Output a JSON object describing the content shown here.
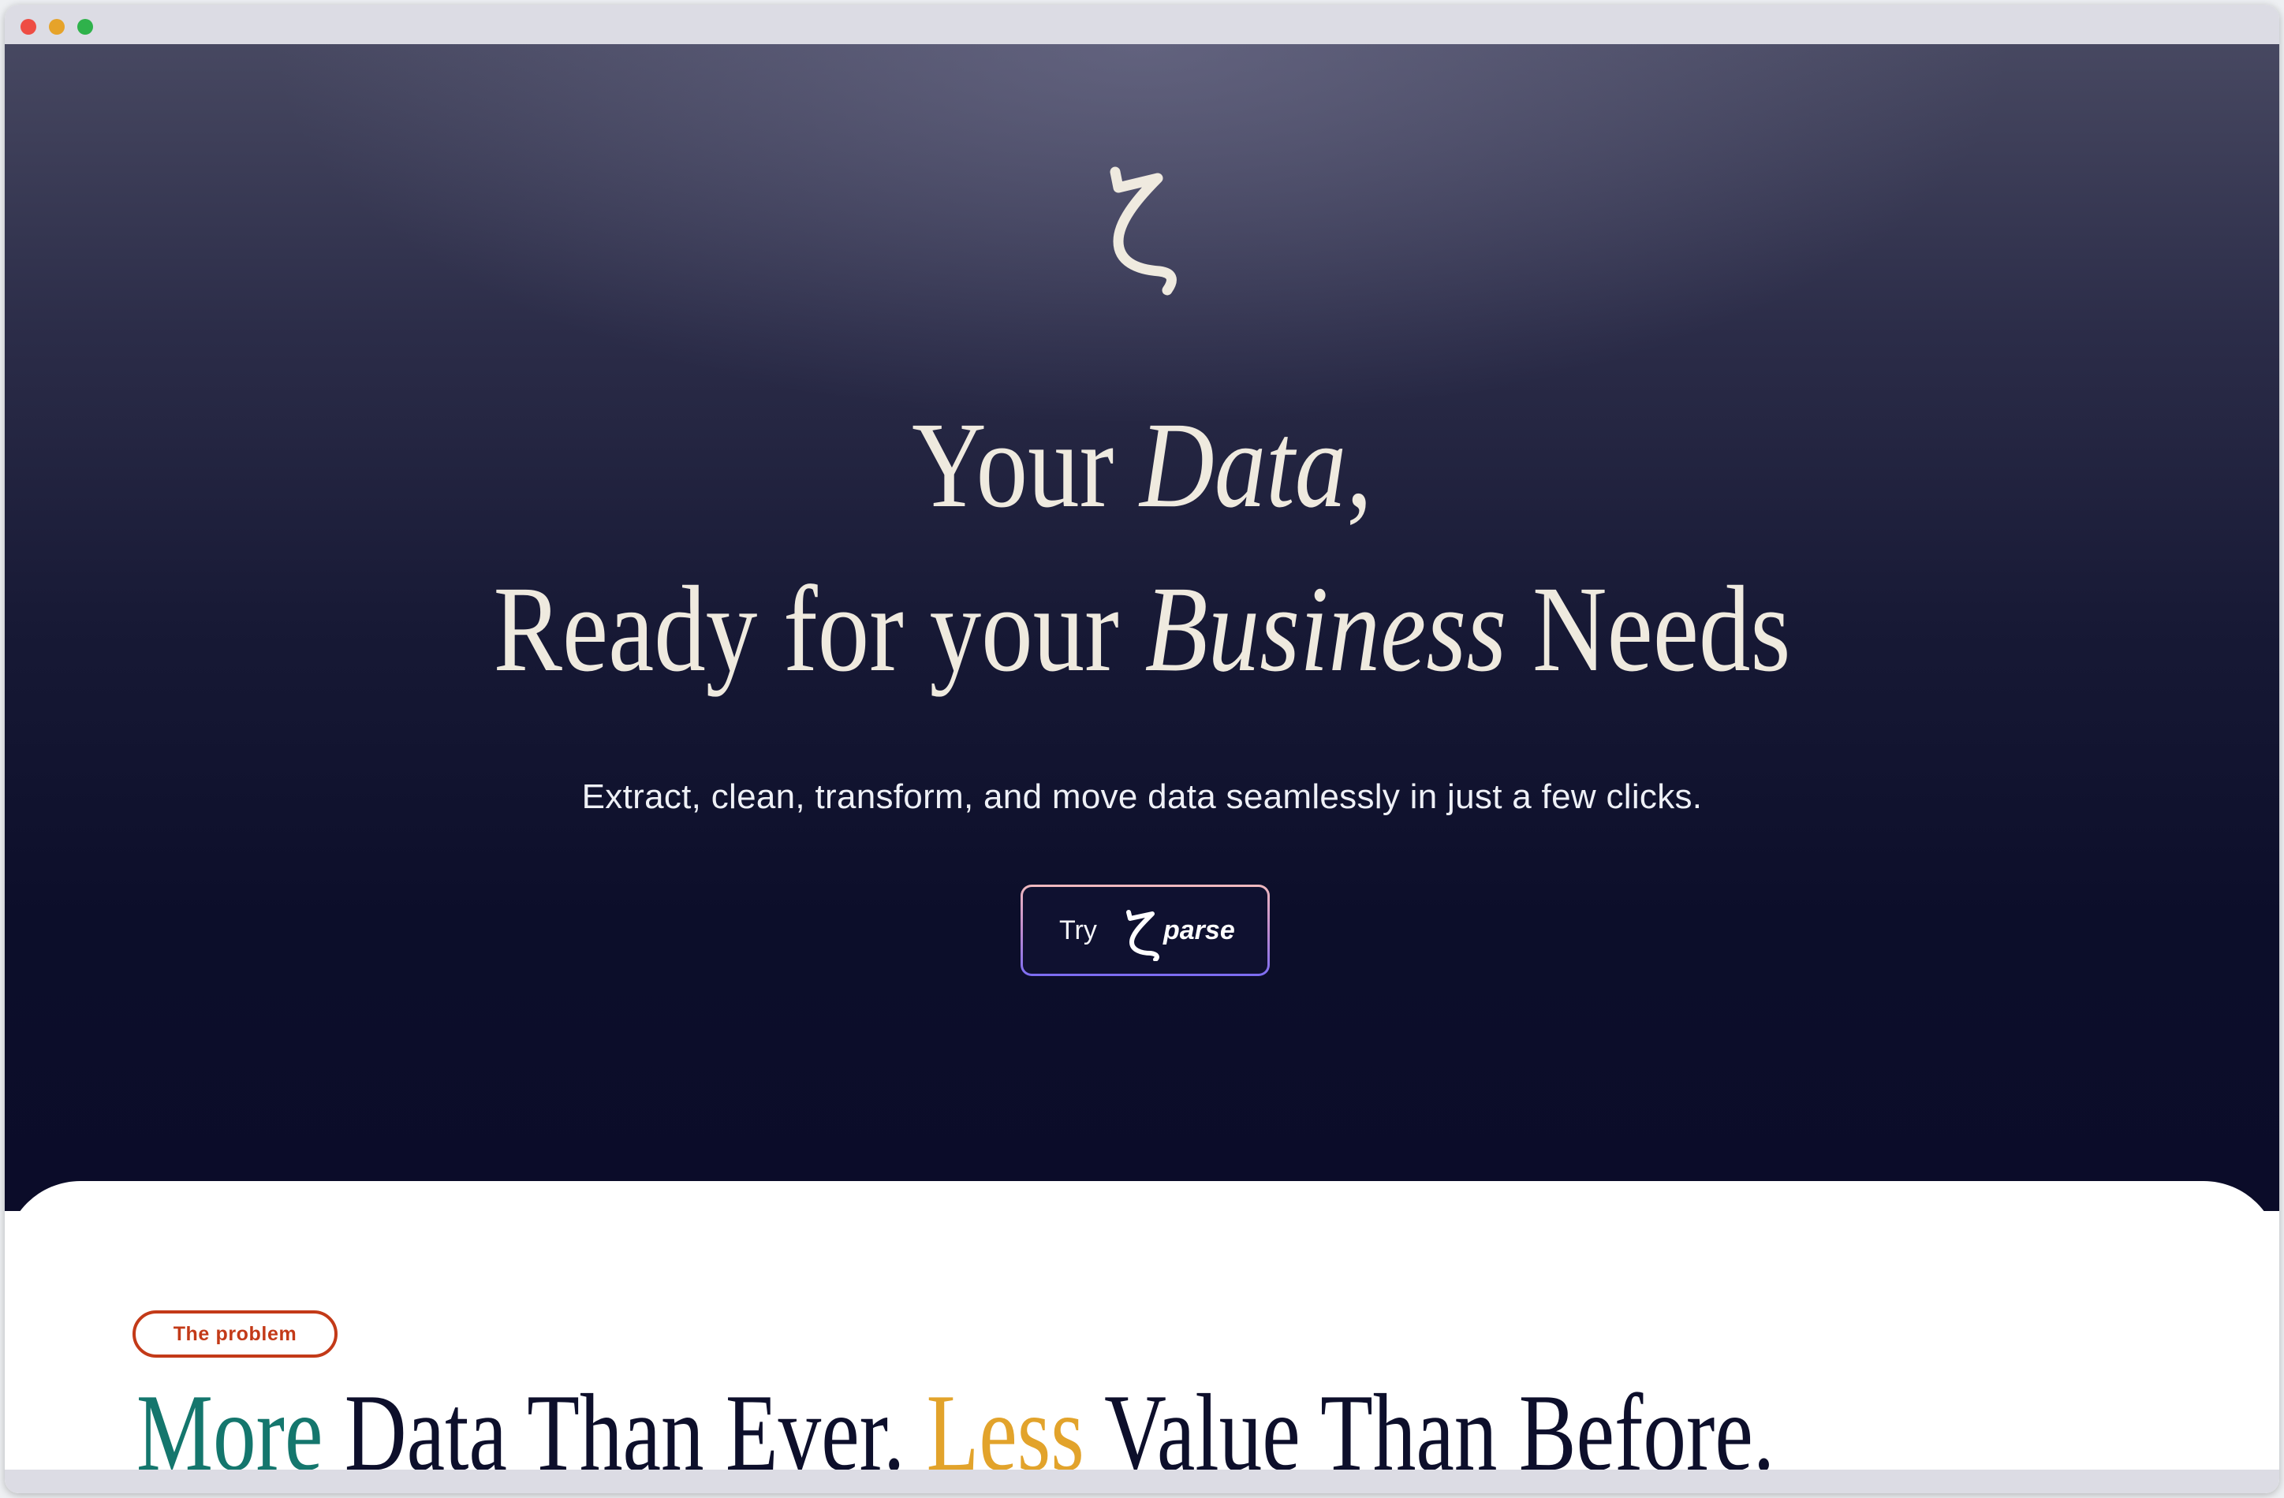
{
  "hero": {
    "headline_line1": {
      "part1": "Your ",
      "part2_italic": "Data",
      "part3": ","
    },
    "headline_line2": {
      "part1": "Ready for your ",
      "part2_italic": "Business",
      "part3": " Needs"
    },
    "subtitle": "Extract, clean, transform, and move data seamlessly in just a few clicks.",
    "cta": {
      "try_label": "Try",
      "product_label": "parse"
    }
  },
  "problem": {
    "badge": "The problem",
    "heading": {
      "part1": "More",
      "part2": " Data Than Ever. ",
      "part3": "Less",
      "part4": " Value Than Before."
    }
  },
  "icons": {
    "brand": "zeta-logo-icon",
    "cta_brand": "zeta-logo-icon"
  },
  "colors": {
    "hero_bg_top": "#474861",
    "hero_bg_bottom": "#0b0c29",
    "headline_text": "#efeadf",
    "badge_accent": "#c33a18",
    "teal_accent": "#14766d",
    "gold_accent": "#e2a32b",
    "heading_text": "#0d0f2b",
    "cta_border_top": "#f0b9be",
    "cta_border_bottom": "#7c6cf2"
  }
}
